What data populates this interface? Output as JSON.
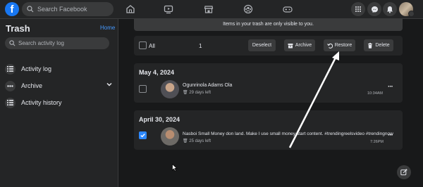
{
  "header": {
    "search_placeholder": "Search Facebook",
    "logo_letter": "f",
    "nav_icons": [
      "home-icon",
      "video-icon",
      "marketplace-icon",
      "groups-icon",
      "gaming-icon"
    ],
    "right_icons": [
      "menu-grid-icon",
      "messenger-icon",
      "notifications-icon"
    ]
  },
  "sidebar": {
    "title": "Trash",
    "home_link": "Home",
    "search_placeholder": "Search activity log",
    "items": [
      {
        "label": "Activity log",
        "icon": "list-icon"
      },
      {
        "label": "Archive",
        "icon": "more-icon"
      },
      {
        "label": "Activity history",
        "icon": "list-icon"
      }
    ]
  },
  "main": {
    "banner": "Items in your trash are only visible to you.",
    "actions": {
      "all_label": "All",
      "selected_count": "1",
      "deselect": "Deselect",
      "archive": "Archive",
      "restore": "Restore",
      "delete": "Delete"
    },
    "groups": [
      {
        "date": "May 4, 2024",
        "item": {
          "name": "Ogunrinola Adams Ola",
          "days_left": "29 days left",
          "time": "10:34AM",
          "checked": false
        }
      },
      {
        "date": "April 30, 2024",
        "item": {
          "name": "Nasboi Small Money don land. Make I use small money start content. #trendingreelsvideo #trendingnow",
          "days_left": "25 days left",
          "time": "7:26PM",
          "checked": true
        }
      }
    ]
  },
  "colors": {
    "accent": "#1877f2",
    "link": "#4599ff",
    "checkbox_on": "#2d88ff",
    "annotation_arrow": "#ffffff"
  }
}
